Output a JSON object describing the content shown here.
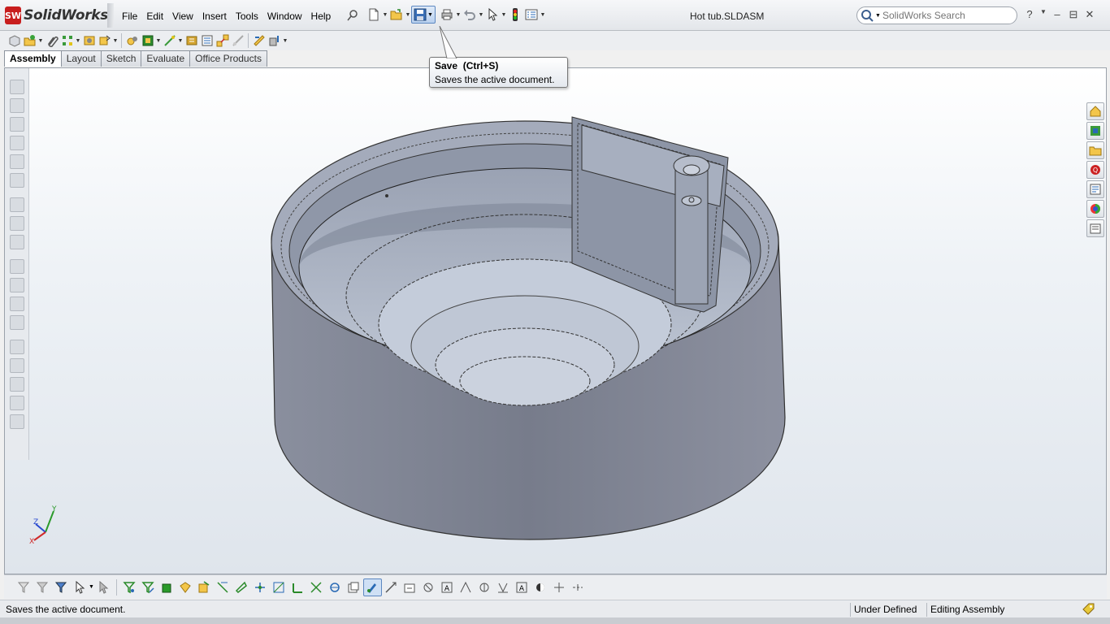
{
  "app": {
    "logo_badge": "SW",
    "logo_text": "SolidWorks",
    "document_title": "Hot tub.SLDASM",
    "accent_color": "#c81e1e"
  },
  "menu": [
    "File",
    "Edit",
    "View",
    "Insert",
    "Tools",
    "Window",
    "Help"
  ],
  "search": {
    "placeholder": "SolidWorks Search"
  },
  "window_controls": {
    "help": "?",
    "minimize": "⊟",
    "close": "✕"
  },
  "tabs": [
    {
      "label": "Assembly",
      "active": true
    },
    {
      "label": "Layout",
      "active": false
    },
    {
      "label": "Sketch",
      "active": false
    },
    {
      "label": "Evaluate",
      "active": false
    },
    {
      "label": "Office Products",
      "active": false
    }
  ],
  "tooltip": {
    "title": "Save",
    "shortcut": "(Ctrl+S)",
    "description": "Saves the active document."
  },
  "status": {
    "message": "Saves the active document.",
    "definition": "Under Defined",
    "mode": "Editing Assembly"
  },
  "triad": {
    "x": "X",
    "y": "Y",
    "z": "Z"
  }
}
